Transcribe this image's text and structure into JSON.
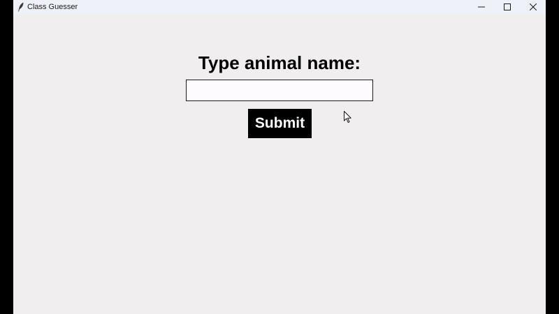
{
  "window": {
    "title": "Class Guesser",
    "icon": "feather-icon",
    "controls": [
      "minimize-icon",
      "maximize-icon",
      "close-icon"
    ]
  },
  "main": {
    "heading": "Type animal name:",
    "animal_input": {
      "value": "",
      "placeholder": ""
    },
    "submit_label": "Submit"
  },
  "colors": {
    "window_bg": "#f0eeef",
    "titlebar_bg": "#eef1f8",
    "button_bg": "#000000",
    "button_text": "#ffffff",
    "outer_bg": "#000000"
  }
}
